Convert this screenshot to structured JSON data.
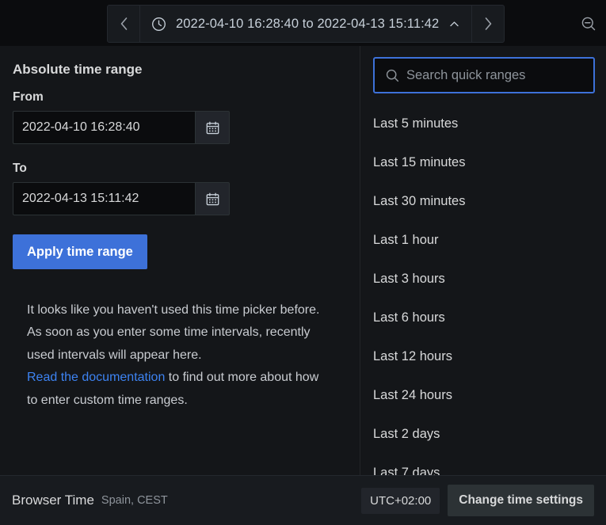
{
  "toolbar": {
    "prev_label": "‹",
    "next_label": "›",
    "range_text": "2022-04-10 16:28:40 to 2022-04-13 15:11:42",
    "collapse_label": "⌃",
    "clock_icon": "clock-icon",
    "zoom_out_icon": "zoom-out-icon"
  },
  "absolute": {
    "title": "Absolute time range",
    "from_label": "From",
    "from_value": "2022-04-10 16:28:40",
    "to_label": "To",
    "to_value": "2022-04-13 15:11:42",
    "apply_label": "Apply time range",
    "calendar_icon": "calendar-icon"
  },
  "help": {
    "paragraph": "It looks like you haven't used this time picker before. As soon as you enter some time intervals, recently used intervals will appear here.",
    "link_text": "Read the documentation",
    "after_link": " to find out more about how to enter custom time ranges."
  },
  "search": {
    "placeholder": "Search quick ranges",
    "value": "",
    "icon": "search-icon"
  },
  "quick_ranges": [
    {
      "label": "Last 5 minutes"
    },
    {
      "label": "Last 15 minutes"
    },
    {
      "label": "Last 30 minutes"
    },
    {
      "label": "Last 1 hour"
    },
    {
      "label": "Last 3 hours"
    },
    {
      "label": "Last 6 hours"
    },
    {
      "label": "Last 12 hours"
    },
    {
      "label": "Last 24 hours"
    },
    {
      "label": "Last 2 days"
    },
    {
      "label": "Last 7 days"
    }
  ],
  "footer": {
    "browser_time_label": "Browser Time",
    "zone_label": "Spain, CEST",
    "utc_offset": "UTC+02:00",
    "change_label": "Change time settings"
  },
  "colors": {
    "accent": "#3d71d9",
    "link": "#3d83f2",
    "panel_bg": "#141619",
    "footer_bg": "#181b1f",
    "text": "#d8d9da",
    "muted": "#8e949b"
  }
}
